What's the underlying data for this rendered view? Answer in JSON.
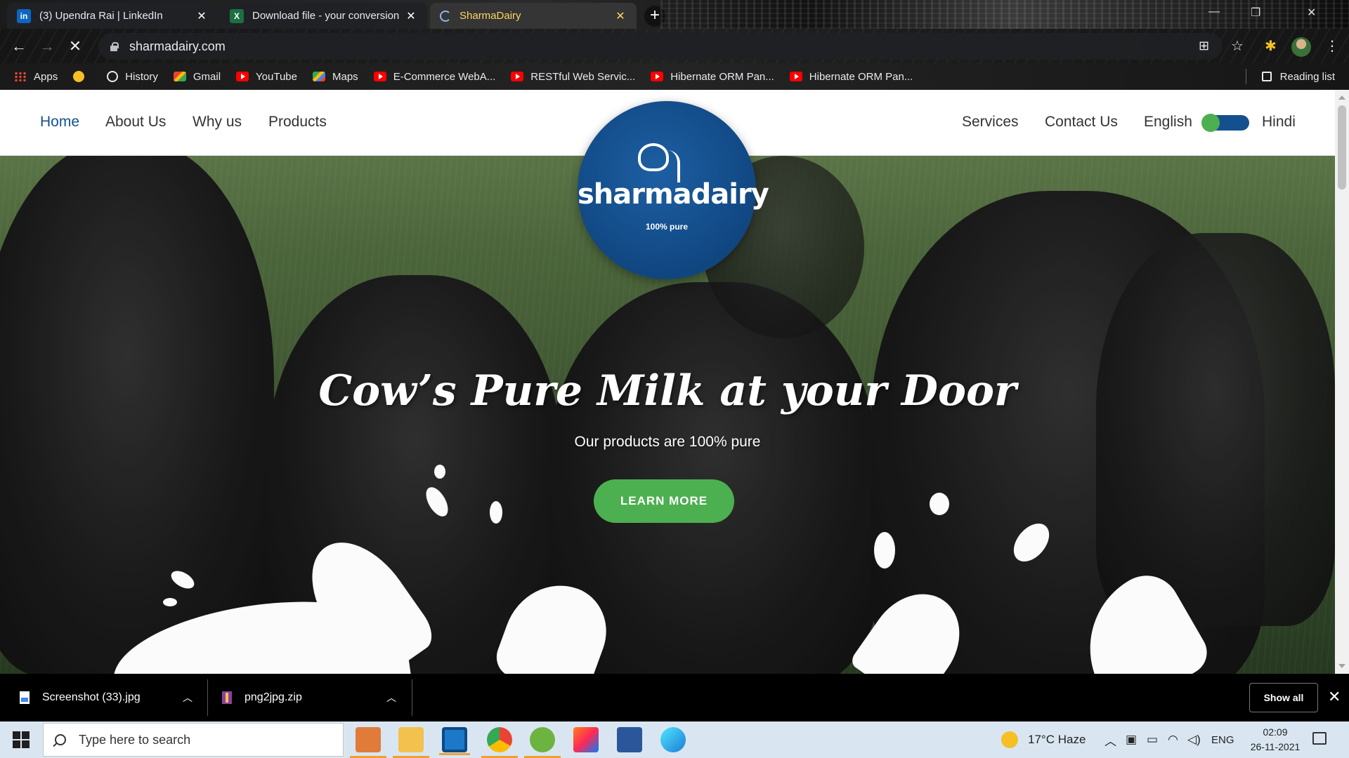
{
  "browser": {
    "tabs": [
      {
        "title": "(3) Upendra Rai | LinkedIn",
        "icon": "linkedin-icon"
      },
      {
        "title": "Download file - your conversion",
        "icon": "excel-icon"
      },
      {
        "title": "SharmaDairy",
        "icon": "loading-spinner-icon"
      }
    ],
    "url": "sharmadairy.com",
    "bookmarks": [
      {
        "label": "Apps",
        "icon": "apps-grid-icon"
      },
      {
        "label": "",
        "icon": "globe-icon"
      },
      {
        "label": "History",
        "icon": "history-icon"
      },
      {
        "label": "Gmail",
        "icon": "gmail-icon"
      },
      {
        "label": "YouTube",
        "icon": "youtube-icon"
      },
      {
        "label": "Maps",
        "icon": "maps-icon"
      },
      {
        "label": "E-Commerce WebA...",
        "icon": "youtube-icon"
      },
      {
        "label": "RESTful Web Servic...",
        "icon": "youtube-icon"
      },
      {
        "label": "Hibernate ORM Pan...",
        "icon": "youtube-icon"
      },
      {
        "label": "Hibernate ORM Pan...",
        "icon": "youtube-icon"
      }
    ],
    "reading_list": "Reading list"
  },
  "site": {
    "nav_left": [
      "Home",
      "About Us",
      "Why us",
      "Products"
    ],
    "nav_right": [
      "Services",
      "Contact Us"
    ],
    "lang_left": "English",
    "lang_right": "Hindi",
    "logo_name": "sharmadairy",
    "logo_tagline": "100% pure",
    "headline": "Cow’s Pure Milk at your Door",
    "subheadline": "Our products are 100% pure",
    "cta": "LEARN MORE",
    "colors": {
      "brand_blue": "#15508e",
      "accent_green": "#4caf50"
    }
  },
  "downloads": {
    "items": [
      {
        "name": "Screenshot (33).jpg",
        "icon": "image-file-icon"
      },
      {
        "name": "png2jpg.zip",
        "icon": "zip-file-icon"
      }
    ],
    "show_all": "Show all"
  },
  "taskbar": {
    "search_placeholder": "Type here to search",
    "weather": "17°C  Haze",
    "language": "ENG",
    "time": "02:09",
    "date": "26-11-2021"
  }
}
